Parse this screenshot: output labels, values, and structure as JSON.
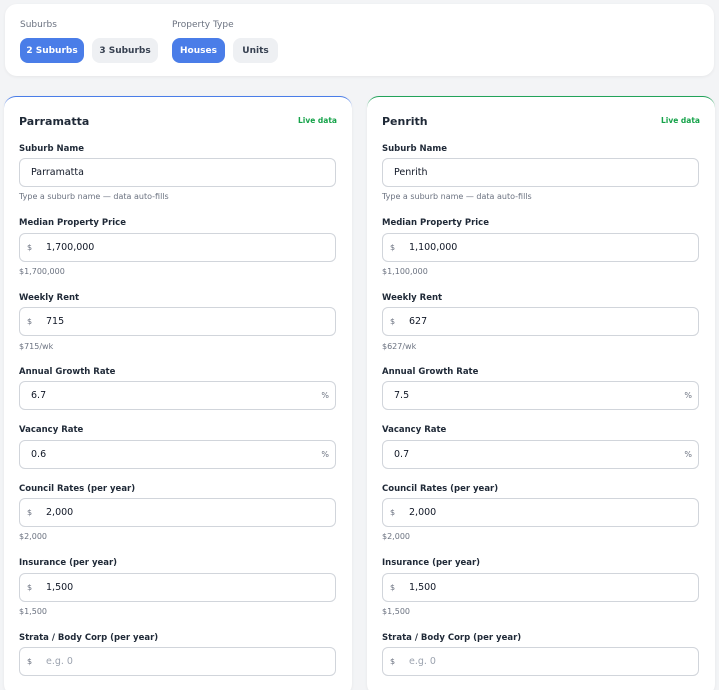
{
  "filters": {
    "suburbs_label": "Suburbs",
    "suburbs_options": [
      "2 Suburbs",
      "3 Suburbs"
    ],
    "property_type_label": "Property Type",
    "property_type_options": [
      "Houses",
      "Units"
    ]
  },
  "colors": {
    "accent": "#4a7de8",
    "live": "#16a34a",
    "card_right_border": "#22a35a"
  },
  "cards": [
    {
      "title": "Parramatta",
      "live_label": "Live data",
      "suburb_name_label": "Suburb Name",
      "suburb_name_value": "Parramatta",
      "suburb_name_hint": "Type a suburb name — data auto-fills",
      "median_price_label": "Median Property Price",
      "median_price_prefix": "$",
      "median_price_value": "1,700,000",
      "median_price_hint": "$1,700,000",
      "weekly_rent_label": "Weekly Rent",
      "weekly_rent_prefix": "$",
      "weekly_rent_value": "715",
      "weekly_rent_hint": "$715/wk",
      "growth_label": "Annual Growth Rate",
      "growth_value": "6.7",
      "growth_suffix": "%",
      "vacancy_label": "Vacancy Rate",
      "vacancy_value": "0.6",
      "vacancy_suffix": "%",
      "council_label": "Council Rates (per year)",
      "council_prefix": "$",
      "council_value": "2,000",
      "council_hint": "$2,000",
      "insurance_label": "Insurance (per year)",
      "insurance_prefix": "$",
      "insurance_value": "1,500",
      "insurance_hint": "$1,500",
      "strata_label": "Strata / Body Corp (per year)",
      "strata_prefix": "$",
      "strata_placeholder": "e.g. 0"
    },
    {
      "title": "Penrith",
      "live_label": "Live data",
      "suburb_name_label": "Suburb Name",
      "suburb_name_value": "Penrith",
      "suburb_name_hint": "Type a suburb name — data auto-fills",
      "median_price_label": "Median Property Price",
      "median_price_prefix": "$",
      "median_price_value": "1,100,000",
      "median_price_hint": "$1,100,000",
      "weekly_rent_label": "Weekly Rent",
      "weekly_rent_prefix": "$",
      "weekly_rent_value": "627",
      "weekly_rent_hint": "$627/wk",
      "growth_label": "Annual Growth Rate",
      "growth_value": "7.5",
      "growth_suffix": "%",
      "vacancy_label": "Vacancy Rate",
      "vacancy_value": "0.7",
      "vacancy_suffix": "%",
      "council_label": "Council Rates (per year)",
      "council_prefix": "$",
      "council_value": "2,000",
      "council_hint": "$2,000",
      "insurance_label": "Insurance (per year)",
      "insurance_prefix": "$",
      "insurance_value": "1,500",
      "insurance_hint": "$1,500",
      "strata_label": "Strata / Body Corp (per year)",
      "strata_prefix": "$",
      "strata_placeholder": "e.g. 0"
    }
  ]
}
